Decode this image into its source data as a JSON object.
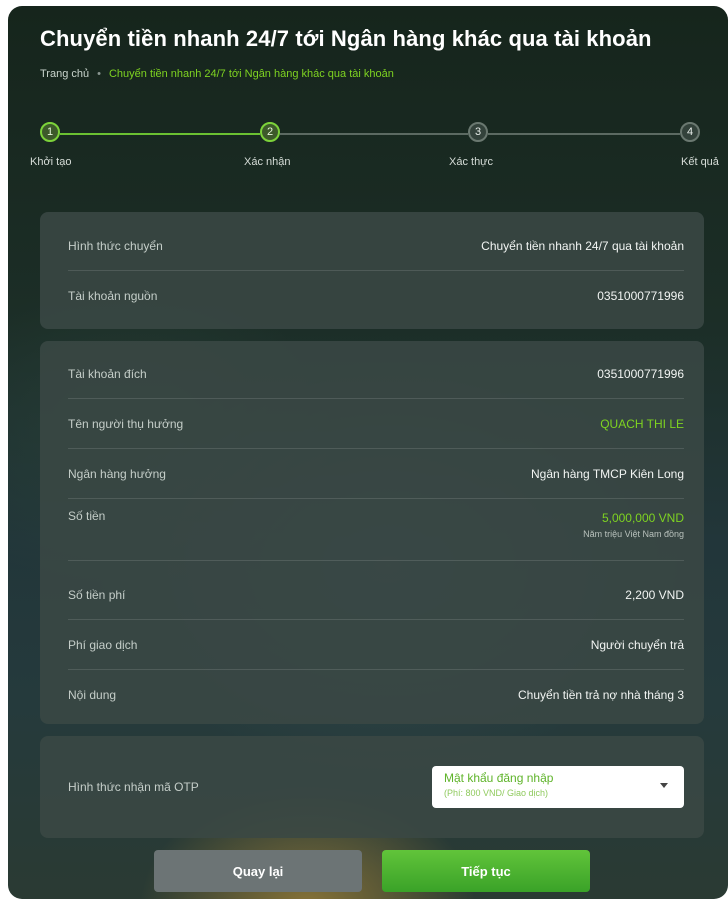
{
  "page": {
    "title": "Chuyển tiền nhanh 24/7 tới Ngân hàng khác qua tài khoản"
  },
  "breadcrumb": {
    "home": "Trang chủ",
    "separator": "•",
    "current": "Chuyển tiền nhanh 24/7 tới Ngân hàng khác qua tài khoản"
  },
  "stepper": {
    "steps": [
      {
        "number": "1",
        "label": "Khởi tạo",
        "state": "done"
      },
      {
        "number": "2",
        "label": "Xác nhận",
        "state": "current"
      },
      {
        "number": "3",
        "label": "Xác thực",
        "state": "pending"
      },
      {
        "number": "4",
        "label": "Kết quả",
        "state": "pending"
      }
    ]
  },
  "source": {
    "rows": [
      {
        "label": "Hình thức chuyển",
        "value": "Chuyển tiền nhanh 24/7 qua tài khoản"
      },
      {
        "label": "Tài khoản nguồn",
        "value": "0351000771996"
      }
    ]
  },
  "details": {
    "destination_account": {
      "label": "Tài khoản đích",
      "value": "0351000771996"
    },
    "beneficiary": {
      "label": "Tên người thụ hưởng",
      "value": "QUACH THI LE"
    },
    "bank": {
      "label": "Ngân hàng hưởng",
      "value": "Ngân hàng TMCP Kiên Long"
    },
    "amount": {
      "label": "Số tiền",
      "value": "5,000,000 VND",
      "in_words": "Năm triệu Việt Nam đồng"
    },
    "fee": {
      "label": "Số tiền phí",
      "value": "2,200 VND"
    },
    "fee_payer": {
      "label": "Phí giao dịch",
      "value": "Người chuyển trả"
    },
    "content": {
      "label": "Nội dung",
      "value": "Chuyển tiền trả nợ nhà tháng 3"
    }
  },
  "otp": {
    "label": "Hình thức nhận mã OTP",
    "selected": "Mật khẩu đăng nhập",
    "selected_note": "(Phí: 800 VND/ Giao dịch)"
  },
  "buttons": {
    "back": "Quay lại",
    "next": "Tiếp tục"
  },
  "colors": {
    "accent": "#7ed321",
    "primary_button": "#4caf32",
    "secondary_button": "#6c7475"
  }
}
